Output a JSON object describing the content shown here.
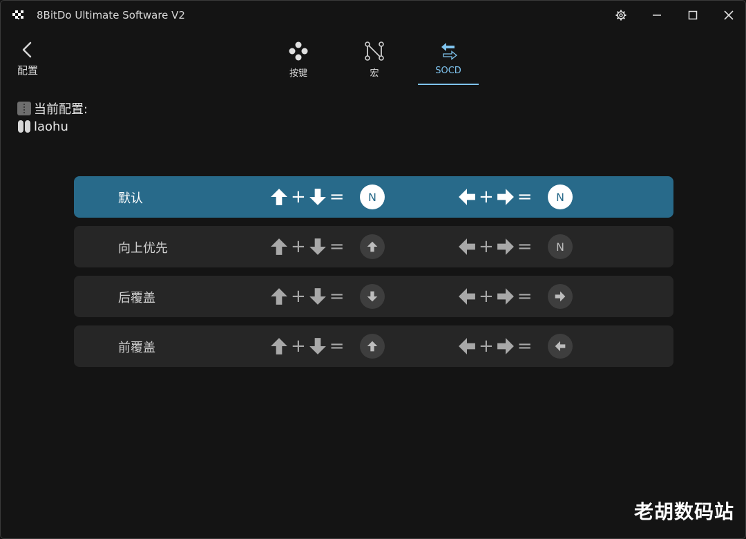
{
  "window": {
    "title": "8BitDo Ultimate Software V2"
  },
  "nav": {
    "back_label": "配置"
  },
  "tabs": [
    {
      "label": "按键",
      "icon": "buttons-icon",
      "active": false
    },
    {
      "label": "宏",
      "icon": "macro-icon",
      "active": false
    },
    {
      "label": "SOCD",
      "icon": "socd-icon",
      "active": true
    }
  ],
  "config": {
    "heading": "当前配置:",
    "profile_name": "laohu"
  },
  "socd_modes": [
    {
      "name": "默认",
      "vertical_result": "N",
      "horizontal_result": "N",
      "selected": true
    },
    {
      "name": "向上优先",
      "vertical_result": "arrow-up",
      "horizontal_result": "N",
      "selected": false
    },
    {
      "name": "后覆盖",
      "vertical_result": "arrow-down",
      "horizontal_result": "arrow-right",
      "selected": false
    },
    {
      "name": "前覆盖",
      "vertical_result": "arrow-up",
      "horizontal_result": "arrow-left",
      "selected": false
    }
  ],
  "symbols": {
    "plus": "+",
    "equals": "="
  },
  "watermark": "老胡数码站",
  "colors": {
    "accent": "#7fc3ee",
    "selected_row": "#286a8a",
    "row_bg": "#262626",
    "background": "#141414"
  }
}
